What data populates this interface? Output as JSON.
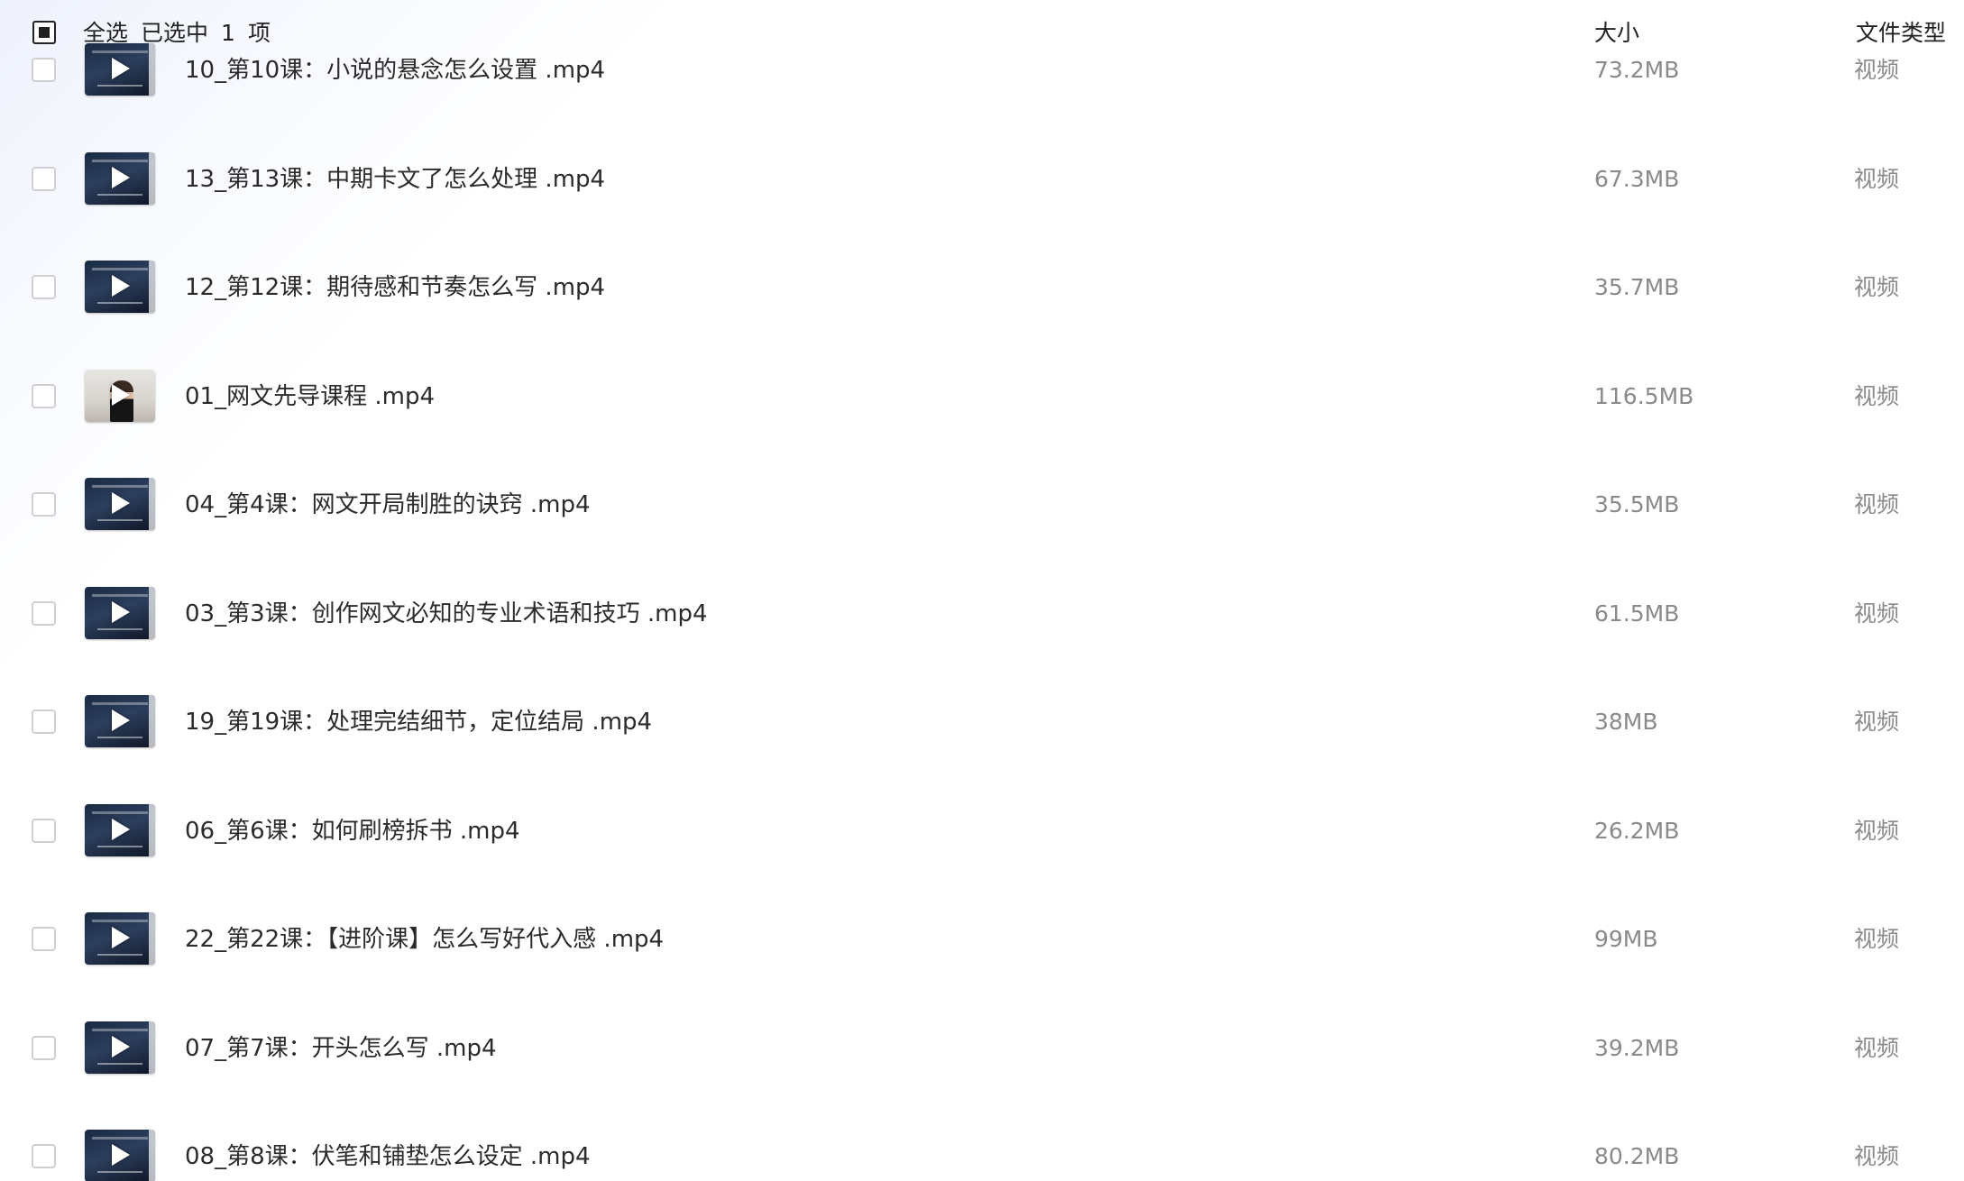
{
  "header": {
    "select_all_label": "全选",
    "selected_label": "已选中",
    "selected_count": "1",
    "item_unit": "项",
    "size_column": "大小",
    "type_column": "文件类型"
  },
  "files": [
    {
      "name": "10_第10课：小说的悬念怎么设置 .mp4",
      "size": "73.2MB",
      "type": "视频",
      "thumb": "video-dark"
    },
    {
      "name": "13_第13课：中期卡文了怎么处理 .mp4",
      "size": "67.3MB",
      "type": "视频",
      "thumb": "video-dark"
    },
    {
      "name": "12_第12课：期待感和节奏怎么写 .mp4",
      "size": "35.7MB",
      "type": "视频",
      "thumb": "video-dark"
    },
    {
      "name": "01_网文先导课程 .mp4",
      "size": "116.5MB",
      "type": "视频",
      "thumb": "person"
    },
    {
      "name": "04_第4课：网文开局制胜的诀窍 .mp4",
      "size": "35.5MB",
      "type": "视频",
      "thumb": "video-dark"
    },
    {
      "name": "03_第3课：创作网文必知的专业术语和技巧 .mp4",
      "size": "61.5MB",
      "type": "视频",
      "thumb": "video-dark"
    },
    {
      "name": "19_第19课：处理完结细节，定位结局 .mp4",
      "size": "38MB",
      "type": "视频",
      "thumb": "video-dark"
    },
    {
      "name": "06_第6课：如何刷榜拆书 .mp4",
      "size": "26.2MB",
      "type": "视频",
      "thumb": "video-dark"
    },
    {
      "name": "22_第22课：【进阶课】怎么写好代入感 .mp4",
      "size": "99MB",
      "type": "视频",
      "thumb": "video-dark"
    },
    {
      "name": "07_第7课：开头怎么写 .mp4",
      "size": "39.2MB",
      "type": "视频",
      "thumb": "video-dark"
    },
    {
      "name": "08_第8课：伏笔和铺垫怎么设定 .mp4",
      "size": "80.2MB",
      "type": "视频",
      "thumb": "video-dark"
    }
  ]
}
